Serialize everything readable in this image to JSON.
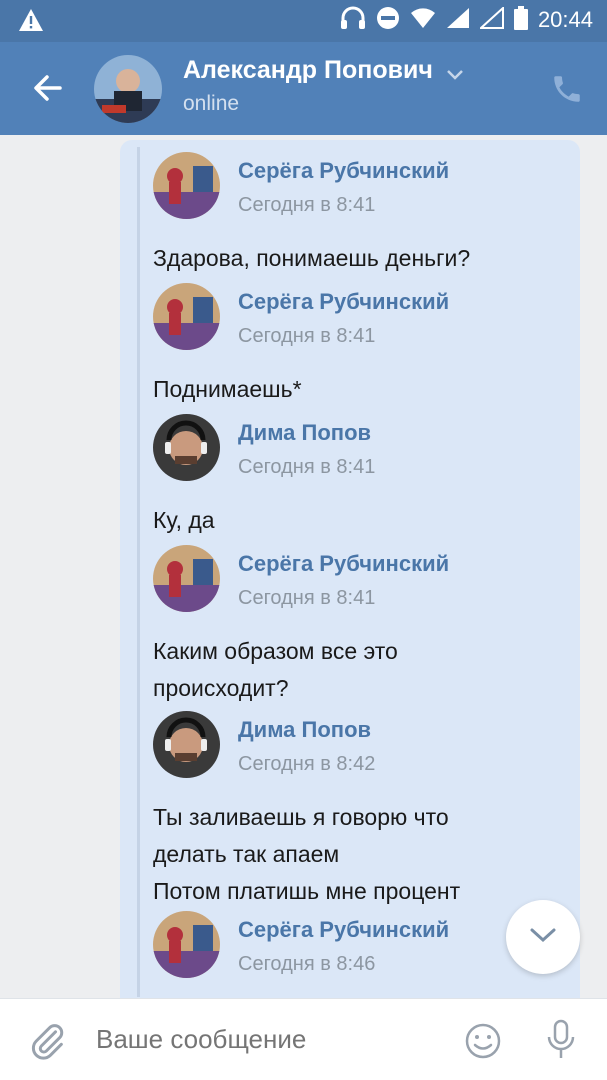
{
  "statusbar": {
    "time": "20:44"
  },
  "header": {
    "name": "Александр Попович",
    "status": "online"
  },
  "messages": [
    {
      "author": "Серёга Рубчинский",
      "time": "Сегодня в 8:41",
      "text": "Здарова, понимаешь деньги?",
      "avatar": "serega"
    },
    {
      "author": "Серёга Рубчинский",
      "time": "Сегодня в 8:41",
      "text": "Поднимаешь*",
      "avatar": "serega"
    },
    {
      "author": "Дима Попов",
      "time": "Сегодня в 8:41",
      "text": "Ку, да",
      "avatar": "dima"
    },
    {
      "author": "Серёга Рубчинский",
      "time": "Сегодня в 8:41",
      "text": "Каким образом все это\nпроисходит?",
      "avatar": "serega"
    },
    {
      "author": "Дима Попов",
      "time": "Сегодня в 8:42",
      "text": "Ты заливаешь я говорю  что\nделать  так апаем\nПотом платишь мне процент",
      "avatar": "dima"
    },
    {
      "author": "Серёга Рубчинский",
      "time": "Сегодня в 8:46",
      "text": "",
      "avatar": "serega"
    }
  ],
  "composer": {
    "placeholder": "Ваше сообщение"
  },
  "colors": {
    "header": "#5181b8",
    "statusbar": "#4a76a8",
    "accent": "#4a76a8",
    "bubble": "#dbe7f7"
  }
}
